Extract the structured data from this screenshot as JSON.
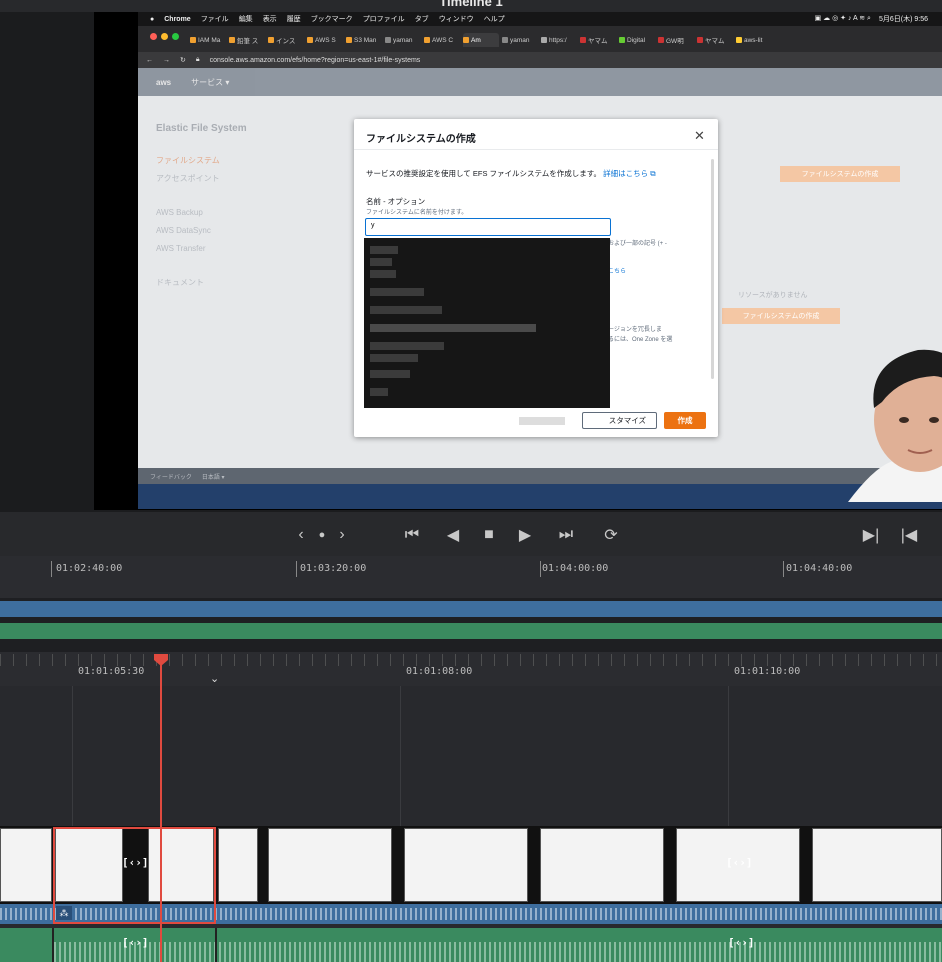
{
  "app": {
    "timeline_title": "Timeline 1"
  },
  "mac_menubar": {
    "items": [
      "Chrome",
      "ファイル",
      "編集",
      "表示",
      "履歴",
      "ブックマーク",
      "プロファイル",
      "タブ",
      "ウィンドウ",
      "ヘルプ"
    ],
    "clock": "5月6日(木) 9:56"
  },
  "browser": {
    "tabs": [
      "IAM Ma",
      "鉛筆 ス",
      "インス",
      "AWS S",
      "S3 Man",
      "yaman",
      "AWS C",
      "Am",
      "yaman",
      "https:/",
      "ヤマム",
      "Digital",
      "GW明",
      "ヤマム",
      "aws-lit"
    ],
    "active_tab_index": 7,
    "url": "console.aws.amazon.com/efs/home?region=us-east-1#/file-systems"
  },
  "aws": {
    "header_items": [
      "aws",
      "サービス ▾"
    ],
    "sidebar_title": "Elastic File System",
    "sidebar_items": [
      "ファイルシステム",
      "アクセスポイント",
      "AWS Backup",
      "AWS DataSync",
      "AWS Transfer",
      "ドキュメント"
    ],
    "bg_create_button": "ファイルシステムの作成",
    "bg_no_resources": "リソースがありません",
    "footer": [
      "フィードバック",
      "日本語 ▾"
    ]
  },
  "modal": {
    "title": "ファイルシステムの作成",
    "description": "サービスの推奨設定を使用して EFS ファイルシステムを作成します。",
    "learn_more": "詳細はこちら",
    "name_label": "名前 - オプション",
    "name_help": "ファイルシステムに名前を付けます。",
    "name_value": "y",
    "bg_text_1": "、および一部の記号 (+ -",
    "bg_text_2": "はこちら",
    "bg_text_3": "リージョンを冗長しま",
    "bg_text_4": "するには、One Zone を選",
    "customize_button": "スタマイズ",
    "create_button": "作成"
  },
  "transport": {
    "buttons": [
      "prev-clip",
      "jog",
      "next-clip",
      "go-to-start",
      "play-reverse",
      "stop",
      "play",
      "go-to-end",
      "loop",
      "mark-in",
      "mark-out"
    ]
  },
  "overview_timeline": {
    "ticks": [
      "01:02:40:00",
      "01:03:20:00",
      "01:04:00:00",
      "01:04:40:00"
    ]
  },
  "detail_timeline": {
    "ticks": [
      "01:01:05:30",
      "01:01:08:00",
      "01:01:10:00"
    ]
  },
  "transition_badges": [
    "[‹›]",
    "[‹›]",
    "[‹›]",
    "[‹›]"
  ]
}
